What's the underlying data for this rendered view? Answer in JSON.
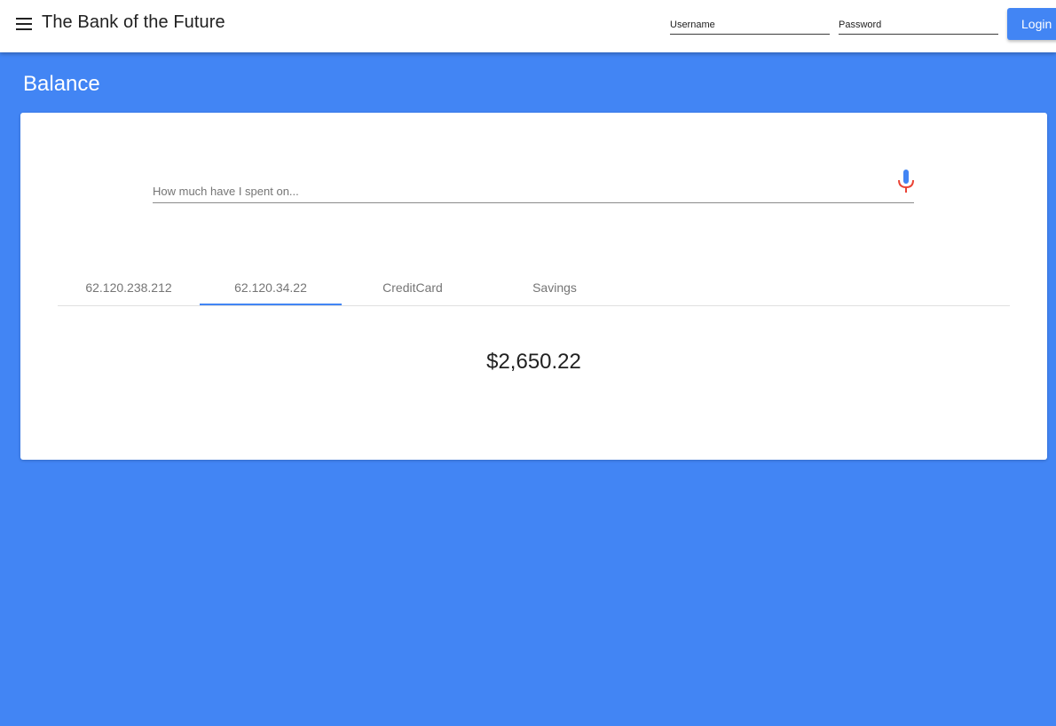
{
  "header": {
    "app_title": "The Bank of the Future",
    "menu_icon": "hamburger-menu-icon",
    "username_placeholder": "Username",
    "password_placeholder": "Password",
    "login_label": "Login"
  },
  "page": {
    "title": "Balance"
  },
  "search": {
    "placeholder": "How much have I spent on...",
    "value": "",
    "voice_icon": "microphone-icon"
  },
  "tabs": [
    {
      "label": "62.120.238.212",
      "selected": false
    },
    {
      "label": "62.120.34.22",
      "selected": true
    },
    {
      "label": "CreditCard",
      "selected": false
    },
    {
      "label": "Savings",
      "selected": false
    }
  ],
  "balance": {
    "amount": "$2,650.22"
  },
  "colors": {
    "accent": "#4285f4",
    "background": "#4285f4",
    "toolbar": "#ffffff",
    "mic_blue": "#4285f4",
    "mic_red": "#ea4335"
  }
}
